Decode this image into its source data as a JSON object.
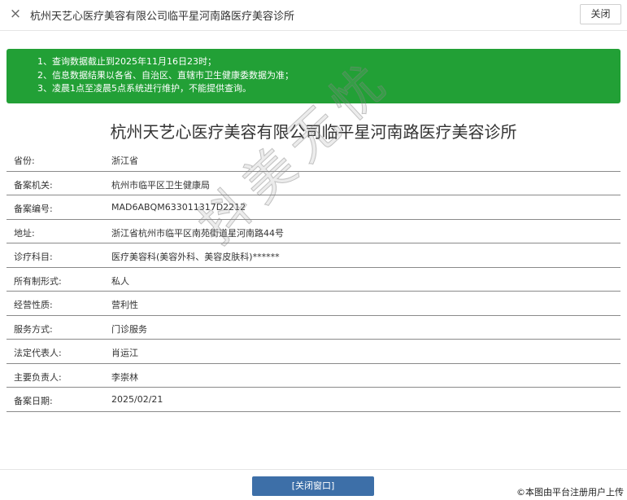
{
  "window": {
    "close_icon": "×",
    "title": "杭州天艺心医疗美容有限公司临平星河南路医疗美容诊所",
    "close_label": "关闭"
  },
  "notice": {
    "lines": [
      "1、查询数据截止到2025年11月16日23时；",
      "2、信息数据结果以各省、自治区、直辖市卫生健康委数据为准；",
      "3、凌晨1点至凌晨5点系统进行维护，不能提供查询。"
    ]
  },
  "main_title": "杭州天艺心医疗美容有限公司临平星河南路医疗美容诊所",
  "rows": [
    {
      "label": "省份:",
      "value": "浙江省"
    },
    {
      "label": "备案机关:",
      "value": "杭州市临平区卫生健康局"
    },
    {
      "label": "备案编号:",
      "value": "MAD6ABQM633011317D2212"
    },
    {
      "label": "地址:",
      "value": "浙江省杭州市临平区南苑街道星河南路44号"
    },
    {
      "label": "诊疗科目:",
      "value": "医疗美容科(美容外科、美容皮肤科)******"
    },
    {
      "label": "所有制形式:",
      "value": "私人"
    },
    {
      "label": "经营性质:",
      "value": "营利性"
    },
    {
      "label": "服务方式:",
      "value": "门诊服务"
    },
    {
      "label": "法定代表人:",
      "value": "肖运江"
    },
    {
      "label": "主要负责人:",
      "value": "李崇林"
    },
    {
      "label": "备案日期:",
      "value": "2025/02/21"
    }
  ],
  "footer": {
    "close_window_label": "[关闭窗口]"
  },
  "watermark": "抖美无忧",
  "credit": "©本图由平台注册用户上传",
  "colors": {
    "notice_bg": "#22a036",
    "button_bg": "#3d6fa8"
  }
}
